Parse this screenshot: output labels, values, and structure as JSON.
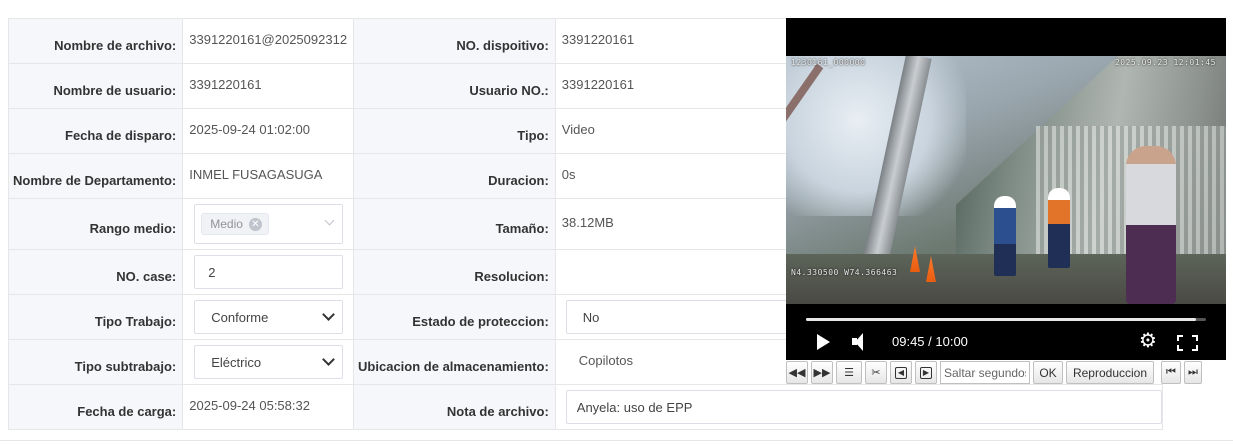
{
  "form": {
    "nombre_archivo": {
      "label": "Nombre de archivo:",
      "value": "3391220161@2025092312"
    },
    "no_dispositivo": {
      "label": "NO. dispoitivo:",
      "value": "3391220161"
    },
    "nombre_usuario": {
      "label": "Nombre de usuario:",
      "value": "3391220161"
    },
    "usuario_no": {
      "label": "Usuario NO.:",
      "value": "3391220161"
    },
    "fecha_disparo": {
      "label": "Fecha de disparo:",
      "value": "2025-09-24 01:02:00"
    },
    "tipo": {
      "label": "Tipo:",
      "value": "Video"
    },
    "nombre_departamento": {
      "label": "Nombre de Departamento:",
      "value": "INMEL FUSAGASUGA"
    },
    "duracion": {
      "label": "Duracion:",
      "value": "0s"
    },
    "rango_medio": {
      "label": "Rango medio:",
      "tag": "Medio"
    },
    "tamano": {
      "label": "Tamaño:",
      "value": "38.12MB"
    },
    "no_case": {
      "label": "NO. case:",
      "value": "2"
    },
    "resolucion": {
      "label": "Resolucion:",
      "value": ""
    },
    "tipo_trabajo": {
      "label": "Tipo Trabajo:",
      "value": "Conforme"
    },
    "estado_proteccion": {
      "label": "Estado de proteccion:",
      "value": "No"
    },
    "tipo_subtrabajo": {
      "label": "Tipo subtrabajo:",
      "value": "Eléctrico"
    },
    "ubicacion": {
      "label": "Ubicacion de almacenamiento:",
      "value": "Copilotos"
    },
    "fecha_carga": {
      "label": "Fecha de carga:",
      "value": "2025-09-24 05:58:32"
    },
    "nota_archivo": {
      "label": "Nota de archivo:",
      "value": "Anyela: uso de EPP"
    }
  },
  "video": {
    "osd_device": "1230161_000000",
    "osd_datetime": "2025.09.23 12:01:45",
    "osd_gps": "N4.330500 W74.366463",
    "time_display": "09:45 / 10:00",
    "progress_fraction": 0.975
  },
  "toolbar": {
    "seek_placeholder": "Saltar segundos",
    "ok_label": "OK",
    "playback_label": "Reproduccion"
  },
  "icons": {
    "play": "play-icon",
    "volume": "volume-icon",
    "settings": "gear-icon",
    "fullscreen": "fullscreen-icon"
  }
}
